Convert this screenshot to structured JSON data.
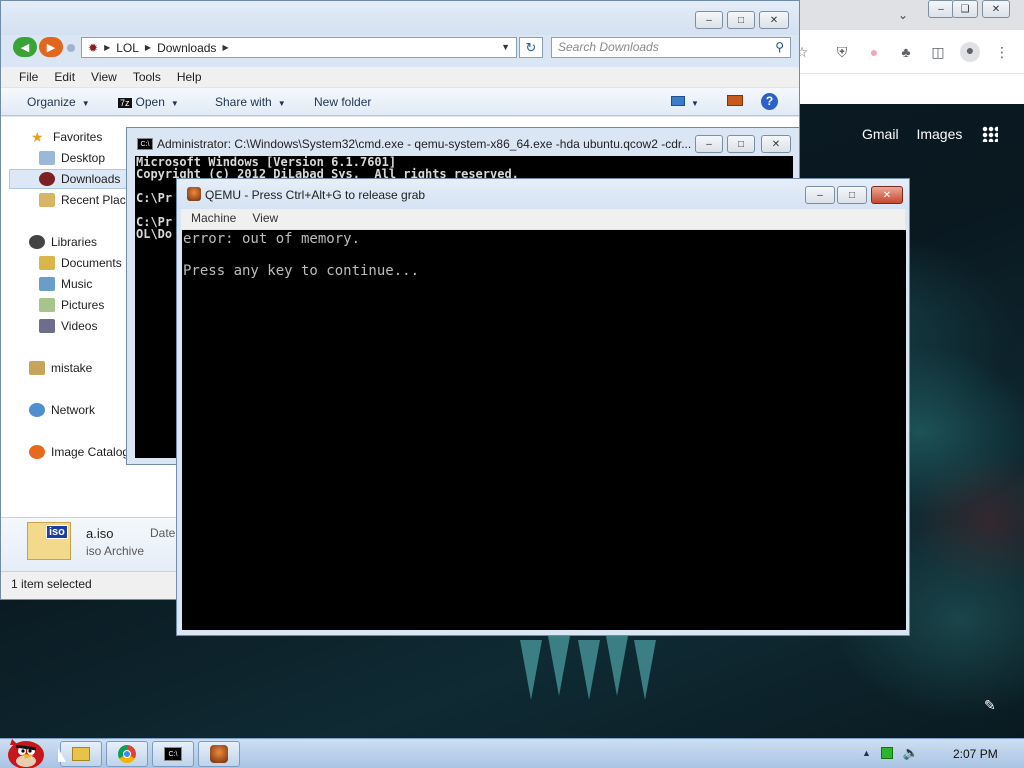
{
  "explorer": {
    "address": [
      "LOL",
      "Downloads"
    ],
    "search_placeholder": "Search Downloads",
    "menu": [
      "File",
      "Edit",
      "View",
      "Tools",
      "Help"
    ],
    "commands": {
      "organize": "Organize",
      "open": "Open",
      "share_with": "Share with",
      "new_folder": "New folder"
    },
    "nav": {
      "favorites": "Favorites",
      "desktop": "Desktop",
      "downloads": "Downloads",
      "recent": "Recent Places",
      "libraries": "Libraries",
      "documents": "Documents",
      "music": "Music",
      "pictures": "Pictures",
      "videos": "Videos",
      "mistake": "mistake",
      "network": "Network",
      "image_catalog": "Image Catalog"
    },
    "details": {
      "name": "a.iso",
      "type": "iso Archive",
      "date_label": "Date",
      "icon_text": "iso"
    },
    "status": "1 item selected"
  },
  "cmd": {
    "title": "Administrator: C:\\Windows\\System32\\cmd.exe - qemu-system-x86_64.exe  -hda ubuntu.qcow2 -cdr...",
    "icon_text": "C:\\",
    "lines": [
      "Microsoft Windows [Version 6.1.7601]",
      "Copyright (c) 2012 DiLabad Sys.  All rights reserved.",
      "",
      "C:\\Pr",
      "",
      "C:\\Pr",
      "OL\\Do"
    ]
  },
  "qemu": {
    "title": "QEMU - Press Ctrl+Alt+G to release grab",
    "menu": [
      "Machine",
      "View"
    ],
    "screen_lines": [
      "error: out of memory.",
      "",
      "Press any key to continue..."
    ]
  },
  "chrome": {
    "links": [
      "Gmail",
      "Images"
    ]
  },
  "taskbar": {
    "clock": "2:07 PM",
    "cmd_icon_text": "C:\\"
  }
}
